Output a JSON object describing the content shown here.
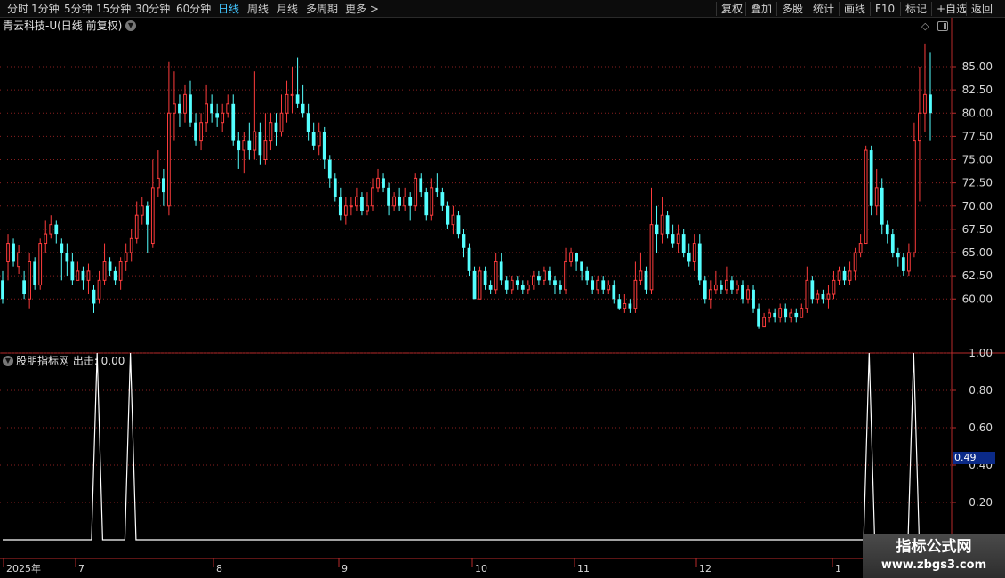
{
  "toolbar": {
    "periods": [
      "分时",
      "1分钟",
      "5分钟",
      "15分钟",
      "30分钟",
      "60分钟",
      "日线",
      "周线",
      "月线",
      "多周期",
      "更多 >"
    ],
    "active_period": "日线",
    "actions": [
      "复权",
      "叠加",
      "多股",
      "统计",
      "画线",
      "F10",
      "标记",
      "+自选",
      "返回"
    ]
  },
  "price_panel": {
    "title": "青云科技-U(日线 前复权)",
    "y_axis_ticks": [
      "85.00",
      "82.50",
      "80.00",
      "77.50",
      "75.00",
      "72.50",
      "70.00",
      "67.50",
      "65.00",
      "62.50",
      "60.00"
    ]
  },
  "indicator_panel": {
    "title": "股朋指标网 出击: 0.00",
    "y_axis_ticks": [
      "1.00",
      "0.80",
      "0.60",
      "0.40",
      "0.20"
    ],
    "current_value": "0.49"
  },
  "time_axis": [
    "2025年",
    "7",
    "8",
    "9",
    "10",
    "11",
    "12",
    "1"
  ],
  "watermark": {
    "title": "指标公式网",
    "url": "www.zbgs3.com"
  },
  "colors": {
    "up": "#ff3c3c",
    "down": "#54ffff",
    "grid": "#8a1f1f",
    "frame": "#b82a2a",
    "axis_text": "#d8d8d8",
    "indicator_line": "#ffffff"
  },
  "chart_data": [
    {
      "type": "candlestick",
      "title": "青云科技-U(日线 前复权)",
      "ylim": [
        57,
        88
      ],
      "candles": [
        [
          62,
          60,
          63,
          59.5
        ],
        [
          64,
          66,
          67,
          62
        ],
        [
          66,
          64,
          66.5,
          63.5
        ],
        [
          63.5,
          65,
          65.8,
          62.7
        ],
        [
          62,
          60.5,
          63,
          60
        ],
        [
          60,
          64,
          65,
          59
        ],
        [
          64,
          61.5,
          64.5,
          61
        ],
        [
          61.5,
          66,
          66.5,
          61
        ],
        [
          66,
          67,
          68.5,
          65
        ],
        [
          67,
          68,
          69,
          66.5
        ],
        [
          68,
          67,
          68.5,
          66
        ],
        [
          66,
          65,
          66.5,
          62
        ],
        [
          65,
          64,
          66,
          62.5
        ],
        [
          64,
          62,
          65,
          61.5
        ],
        [
          62,
          63,
          64,
          62
        ],
        [
          63,
          62,
          63.5,
          61
        ],
        [
          62,
          63,
          63.8,
          60.5
        ],
        [
          61,
          59.5,
          61.5,
          58.5
        ],
        [
          60,
          62,
          63,
          59.5
        ],
        [
          62,
          64,
          66,
          61.5
        ],
        [
          64,
          63,
          64.5,
          62.5
        ],
        [
          63,
          62,
          63.5,
          61.5
        ],
        [
          62,
          64,
          64.5,
          61
        ],
        [
          64,
          65,
          66,
          63
        ],
        [
          65,
          66.5,
          67.5,
          64
        ],
        [
          66.5,
          69,
          70.5,
          66
        ],
        [
          69,
          70,
          71,
          68
        ],
        [
          70,
          68,
          70.5,
          65
        ],
        [
          66,
          72,
          75,
          65.5
        ],
        [
          72,
          73,
          76,
          71
        ],
        [
          73,
          71.5,
          74,
          70
        ],
        [
          70,
          80,
          85.5,
          69
        ],
        [
          80,
          81,
          84.5,
          77
        ],
        [
          81,
          80,
          82,
          78.5
        ],
        [
          80,
          82,
          83,
          79
        ],
        [
          82,
          79,
          83.5,
          78.5
        ],
        [
          79,
          77,
          80,
          76.5
        ],
        [
          77,
          79,
          80,
          76
        ],
        [
          79,
          81,
          83,
          78
        ],
        [
          81,
          80,
          82,
          79
        ],
        [
          80,
          79.5,
          81,
          78.5
        ],
        [
          79,
          80,
          81,
          78
        ],
        [
          80,
          81,
          82,
          79.5
        ],
        [
          81,
          77,
          82,
          76.5
        ],
        [
          77,
          76,
          78,
          74
        ],
        [
          76,
          77,
          78,
          73.5
        ],
        [
          77,
          76,
          79,
          75
        ],
        [
          76,
          78,
          84.5,
          75
        ],
        [
          78,
          75.5,
          79,
          74.5
        ],
        [
          75,
          77,
          80,
          74.5
        ],
        [
          77,
          79,
          80,
          76
        ],
        [
          79,
          78,
          80,
          76.5
        ],
        [
          78,
          80,
          82,
          77.5
        ],
        [
          80,
          82,
          83.5,
          79
        ],
        [
          82,
          82,
          85,
          80
        ],
        [
          82,
          81,
          86,
          80.5
        ],
        [
          81,
          80,
          83,
          79.5
        ],
        [
          80,
          78,
          81,
          77
        ],
        [
          78,
          76.5,
          79,
          76
        ],
        [
          76.5,
          78,
          79,
          75.5
        ],
        [
          78,
          75,
          78.5,
          74
        ],
        [
          75,
          73,
          75.5,
          72
        ],
        [
          73,
          71,
          73.5,
          70.5
        ],
        [
          71,
          69,
          72,
          68.5
        ],
        [
          69,
          70,
          71,
          68
        ],
        [
          70,
          70,
          71,
          69
        ],
        [
          70,
          71,
          72,
          69.5
        ],
        [
          71,
          69.5,
          71.5,
          69
        ],
        [
          69.5,
          70,
          71.5,
          69
        ],
        [
          70,
          72,
          73,
          69.5
        ],
        [
          72,
          73,
          74,
          71.5
        ],
        [
          73,
          72,
          73.5,
          71.5
        ],
        [
          72,
          70,
          72.5,
          69
        ],
        [
          70,
          71,
          71.5,
          69.5
        ],
        [
          71,
          70,
          72,
          69.5
        ],
        [
          70,
          71,
          72,
          69.5
        ],
        [
          71,
          70,
          71.5,
          68.5
        ],
        [
          70,
          73,
          73.5,
          69.5
        ],
        [
          73,
          71.5,
          73.5,
          71
        ],
        [
          71.5,
          69,
          72,
          68.5
        ],
        [
          69,
          72,
          73,
          68.5
        ],
        [
          72,
          71.5,
          73.5,
          71
        ],
        [
          71.5,
          70,
          72,
          69.5
        ],
        [
          70,
          68,
          70.5,
          67.5
        ],
        [
          68,
          69,
          70,
          67
        ],
        [
          69,
          67,
          69.5,
          66.5
        ],
        [
          67,
          65.5,
          67.5,
          64.5
        ],
        [
          65.5,
          63,
          66,
          62.5
        ],
        [
          63,
          60,
          63.5,
          60
        ],
        [
          60,
          63,
          63.5,
          60
        ],
        [
          63,
          61.5,
          63.5,
          61
        ],
        [
          61.5,
          61,
          62,
          60.5
        ],
        [
          61,
          64,
          65,
          60.5
        ],
        [
          64,
          62,
          65,
          61.5
        ],
        [
          62,
          61,
          62.5,
          60.5
        ],
        [
          61,
          62,
          62.5,
          60.5
        ],
        [
          62,
          61.5,
          62.5,
          61
        ],
        [
          61.5,
          61,
          62,
          60.5
        ],
        [
          61,
          61.5,
          62,
          60.5
        ],
        [
          61.5,
          62.5,
          63,
          61
        ],
        [
          62.5,
          62,
          63,
          61.5
        ],
        [
          62,
          63,
          63.5,
          61.5
        ],
        [
          63,
          62,
          63.5,
          61.5
        ],
        [
          62,
          61.5,
          62.5,
          60.5
        ],
        [
          61.5,
          61,
          62,
          60.5
        ],
        [
          61,
          64,
          65.5,
          60.5
        ],
        [
          64,
          65,
          65.5,
          63.5
        ],
        [
          65,
          64,
          65,
          63
        ],
        [
          64,
          63,
          64,
          62
        ],
        [
          63,
          62,
          63.5,
          61.5
        ],
        [
          62,
          61,
          62.5,
          60.5
        ],
        [
          61,
          62,
          62.5,
          60.5
        ],
        [
          62,
          61,
          62.5,
          60.5
        ],
        [
          61,
          61.5,
          62,
          60.5
        ],
        [
          61.5,
          60,
          62,
          59.5
        ],
        [
          60,
          59,
          60.5,
          58.8
        ],
        [
          59,
          59.5,
          60.5,
          58.5
        ],
        [
          59.5,
          59,
          60,
          58.5
        ],
        [
          59,
          62,
          64,
          58.5
        ],
        [
          62,
          63,
          65,
          61.5
        ],
        [
          63,
          61,
          63.5,
          60.5
        ],
        [
          61,
          68,
          72,
          60.5
        ],
        [
          68,
          67,
          70,
          65
        ],
        [
          67,
          69,
          71,
          66
        ],
        [
          69,
          67,
          69.5,
          66.5
        ],
        [
          67,
          66,
          68,
          65.5
        ],
        [
          66,
          67,
          68,
          65
        ],
        [
          67,
          65,
          67.5,
          64.5
        ],
        [
          65,
          64,
          66,
          63.5
        ],
        [
          64,
          66,
          67,
          63
        ],
        [
          66,
          62,
          67,
          61.5
        ],
        [
          62,
          60,
          62.5,
          59.5
        ],
        [
          60,
          61,
          62,
          59
        ],
        [
          61,
          61.5,
          63,
          60.5
        ],
        [
          61.5,
          61,
          62,
          60.5
        ],
        [
          61,
          62,
          63.5,
          60.5
        ],
        [
          62,
          61,
          62.5,
          60.5
        ],
        [
          61,
          61.5,
          62,
          60.5
        ],
        [
          61.5,
          60,
          62,
          59.5
        ],
        [
          60,
          61,
          61.5,
          59.5
        ],
        [
          61,
          59,
          61.5,
          58.5
        ],
        [
          59,
          57,
          59.5,
          56.8
        ],
        [
          57,
          58,
          58.5,
          57
        ],
        [
          58,
          58.5,
          59,
          57.5
        ],
        [
          58.5,
          58,
          59,
          57.5
        ],
        [
          58,
          59,
          59.5,
          57.5
        ],
        [
          59,
          58,
          59.5,
          57.5
        ],
        [
          58,
          58.5,
          59,
          57.5
        ],
        [
          58.5,
          58,
          59,
          57.5
        ],
        [
          58,
          59,
          59.5,
          58
        ],
        [
          59,
          62,
          63.5,
          58.5
        ],
        [
          62,
          60,
          62.5,
          59.5
        ],
        [
          60,
          60.5,
          61,
          59.5
        ],
        [
          60.5,
          60,
          61,
          59.5
        ],
        [
          60,
          60.5,
          61.5,
          59
        ],
        [
          60.5,
          62,
          63,
          60
        ],
        [
          62,
          63,
          63.5,
          61.5
        ],
        [
          63,
          62,
          63.5,
          61.5
        ],
        [
          62,
          63,
          64,
          61.5
        ],
        [
          63,
          65,
          65.5,
          62
        ],
        [
          65,
          66,
          67,
          64.5
        ],
        [
          66,
          76,
          76.5,
          66
        ],
        [
          76,
          70,
          76.5,
          69
        ],
        [
          70,
          72,
          74,
          69
        ],
        [
          72,
          68,
          73,
          67
        ],
        [
          68,
          67,
          68.5,
          66
        ],
        [
          67,
          65,
          67.5,
          64.5
        ],
        [
          65,
          64.5,
          65.5,
          63.5
        ],
        [
          64.5,
          63,
          65,
          62.5
        ],
        [
          63,
          65,
          66,
          62.5
        ],
        [
          65,
          77,
          79,
          64.5
        ],
        [
          77,
          80,
          85,
          70.5
        ],
        [
          80,
          82,
          87.5,
          78
        ],
        [
          82,
          80,
          86.5,
          77
        ]
      ]
    },
    {
      "type": "line",
      "title": "股朋指标网 出击: 0.00",
      "ylim": [
        0,
        1
      ],
      "ticks": [
        1.0,
        0.8,
        0.6,
        0.4,
        0.2
      ],
      "current": 0.49,
      "series": [
        {
          "values": [
            0,
            0,
            0,
            0,
            0,
            0,
            0,
            0,
            0,
            0,
            0,
            0,
            0,
            0,
            0,
            0,
            0,
            1,
            0,
            0,
            0,
            0,
            0,
            1,
            0,
            0,
            0,
            0,
            0,
            0,
            0,
            0,
            0,
            0,
            0,
            0,
            0,
            0,
            0,
            0,
            0,
            0,
            0,
            0,
            0,
            0,
            0,
            0,
            0,
            0,
            0,
            0,
            0,
            0,
            0,
            0,
            0,
            0,
            0,
            0,
            0,
            0,
            0,
            0,
            0,
            0,
            0,
            0,
            0,
            0,
            0,
            0,
            0,
            0,
            0,
            0,
            0,
            0,
            0,
            0,
            0,
            0,
            0,
            0,
            0,
            0,
            0,
            0,
            0,
            0,
            0,
            0,
            0,
            0,
            0,
            0,
            0,
            0,
            0,
            0,
            0,
            0,
            0,
            0,
            0,
            0,
            0,
            0,
            0,
            0,
            0,
            0,
            0,
            0,
            0,
            0,
            0,
            0,
            0,
            0,
            0,
            0,
            0,
            0,
            0,
            0,
            0,
            0,
            0,
            0,
            0,
            0,
            0,
            0,
            0,
            0,
            0,
            0,
            0,
            0,
            0,
            0,
            0,
            0,
            0,
            0,
            0,
            0,
            0,
            0,
            0,
            0,
            0,
            0,
            0,
            0,
            1,
            0,
            0,
            0,
            0,
            0,
            0,
            0,
            1,
            0,
            0,
            0
          ]
        }
      ]
    }
  ]
}
